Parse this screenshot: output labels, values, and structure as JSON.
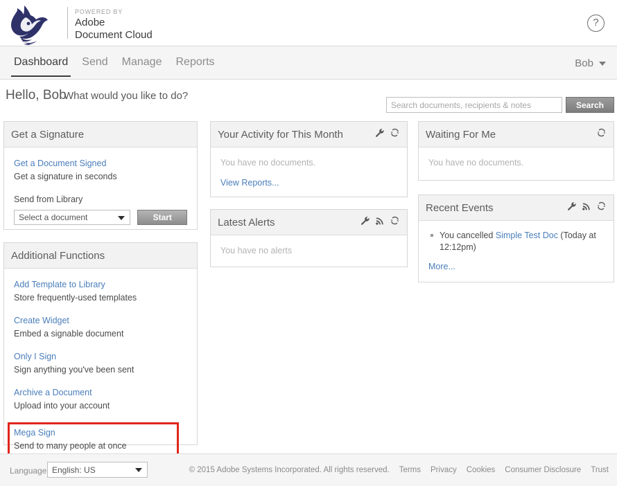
{
  "header": {
    "logo_name": "husky-wolf-head-logo",
    "powered_by": "POWERED BY",
    "brand_line1": "Adobe",
    "brand_line2": "Document Cloud",
    "help_glyph": "?"
  },
  "nav": {
    "items": [
      {
        "label": "Dashboard",
        "active": true
      },
      {
        "label": "Send",
        "active": false
      },
      {
        "label": "Manage",
        "active": false
      },
      {
        "label": "Reports",
        "active": false
      }
    ],
    "user_name": "Bob"
  },
  "greeting": {
    "hello": "Hello, Bob",
    "question": "What would you like to do?"
  },
  "search": {
    "placeholder": "Search documents, recipients & notes",
    "value": "",
    "button_label": "Search"
  },
  "get_signature": {
    "title": "Get a Signature",
    "link_label": "Get a Document Signed",
    "link_desc": "Get a signature in seconds",
    "send_from_library_label": "Send from Library",
    "select_value": "Select a document",
    "start_label": "Start"
  },
  "additional_functions": {
    "title": "Additional Functions",
    "items": [
      {
        "link": "Add Template to Library",
        "desc": "Store frequently-used templates",
        "highlighted": false
      },
      {
        "link": "Create Widget",
        "desc": "Embed a signable document",
        "highlighted": false
      },
      {
        "link": "Only I Sign",
        "desc": "Sign anything you've been sent",
        "highlighted": false
      },
      {
        "link": "Archive a Document",
        "desc": "Upload into your account",
        "highlighted": false
      },
      {
        "link": "Mega Sign",
        "desc": "Send to many people at once",
        "highlighted": true
      }
    ]
  },
  "activity": {
    "title": "Your Activity for This Month",
    "empty_text": "You have no documents.",
    "view_reports_label": "View Reports..."
  },
  "alerts": {
    "title": "Latest Alerts",
    "empty_text": "You have no alerts"
  },
  "waiting": {
    "title": "Waiting For Me",
    "empty_text": "You have no documents."
  },
  "recent_events": {
    "title": "Recent Events",
    "events": [
      {
        "prefix": "You cancelled ",
        "doc_link": "Simple Test Doc",
        "suffix": " (Today at 12:12pm)"
      }
    ],
    "more_label": "More..."
  },
  "footer": {
    "language_label": "Language",
    "language_value": "English: US",
    "copyright": "© 2015 Adobe Systems Incorporated. All rights reserved.",
    "links": [
      "Terms",
      "Privacy",
      "Cookies",
      "Consumer Disclosure",
      "Trust"
    ]
  },
  "colors": {
    "link_blue": "#4a7ebb",
    "highlight_red": "#e0251b",
    "logo_navy": "#2e3269",
    "panel_header_bg": "#f2f2f2",
    "nav_bg": "#f5f5f5"
  }
}
